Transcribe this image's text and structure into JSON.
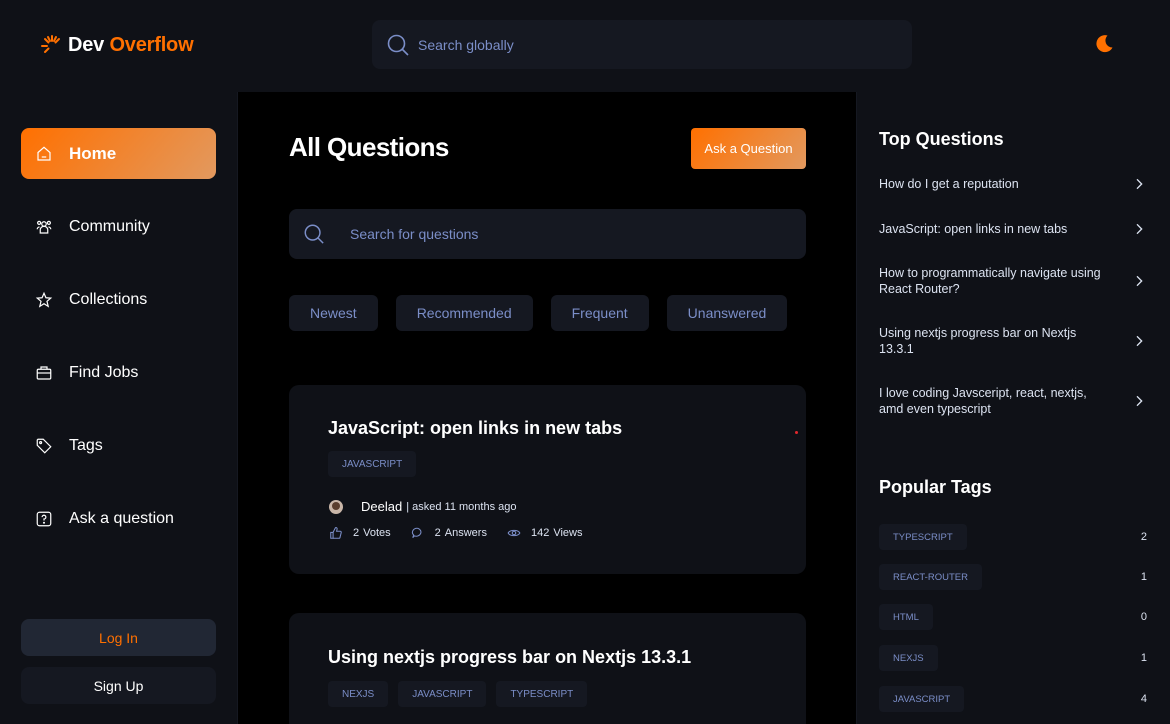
{
  "navbar": {
    "logo_part1": "Dev",
    "logo_part2": "Overflow",
    "search_placeholder": "Search globally",
    "theme_icon": "moon-icon",
    "accent_color": "#ff7000"
  },
  "sidebar": {
    "items": [
      {
        "label": "Home",
        "icon": "home-icon",
        "active": true
      },
      {
        "label": "Community",
        "icon": "users-icon",
        "active": false
      },
      {
        "label": "Collections",
        "icon": "star-icon",
        "active": false
      },
      {
        "label": "Find Jobs",
        "icon": "suitcase-icon",
        "active": false
      },
      {
        "label": "Tags",
        "icon": "tag-icon",
        "active": false
      },
      {
        "label": "Ask a question",
        "icon": "question-icon",
        "active": false
      }
    ],
    "login_label": "Log In",
    "signup_label": "Sign Up"
  },
  "main": {
    "title": "All Questions",
    "ask_button": "Ask a Question",
    "search_placeholder": "Search for questions",
    "filters": [
      "Newest",
      "Recommended",
      "Frequent",
      "Unanswered"
    ],
    "questions": [
      {
        "title": "JavaScript: open links in new tabs",
        "tags": [
          "JAVASCRIPT"
        ],
        "author": "Deelad",
        "asked": "| asked 11 months ago",
        "votes": "2",
        "votes_label": "Votes",
        "answers": "2",
        "answers_label": "Answers",
        "views": "142",
        "views_label": "Views"
      },
      {
        "title": "Using nextjs progress bar on Nextjs 13.3.1",
        "tags": [
          "NEXJS",
          "JAVASCRIPT",
          "TYPESCRIPT"
        ]
      }
    ]
  },
  "right": {
    "top_questions_title": "Top Questions",
    "top_questions": [
      "How do I get a reputation",
      "JavaScript: open links in new tabs",
      "How to programmatically navigate using React Router?",
      "Using nextjs progress bar on Nextjs 13.3.1",
      "I love coding Javsceript, react, nextjs, amd even typescript"
    ],
    "popular_tags_title": "Popular Tags",
    "popular_tags": [
      {
        "name": "TYPESCRIPT",
        "count": "2"
      },
      {
        "name": "REACT-ROUTER",
        "count": "1"
      },
      {
        "name": "HTML",
        "count": "0"
      },
      {
        "name": "NEXJS",
        "count": "1"
      },
      {
        "name": "JAVASCRIPT",
        "count": "4"
      }
    ]
  }
}
